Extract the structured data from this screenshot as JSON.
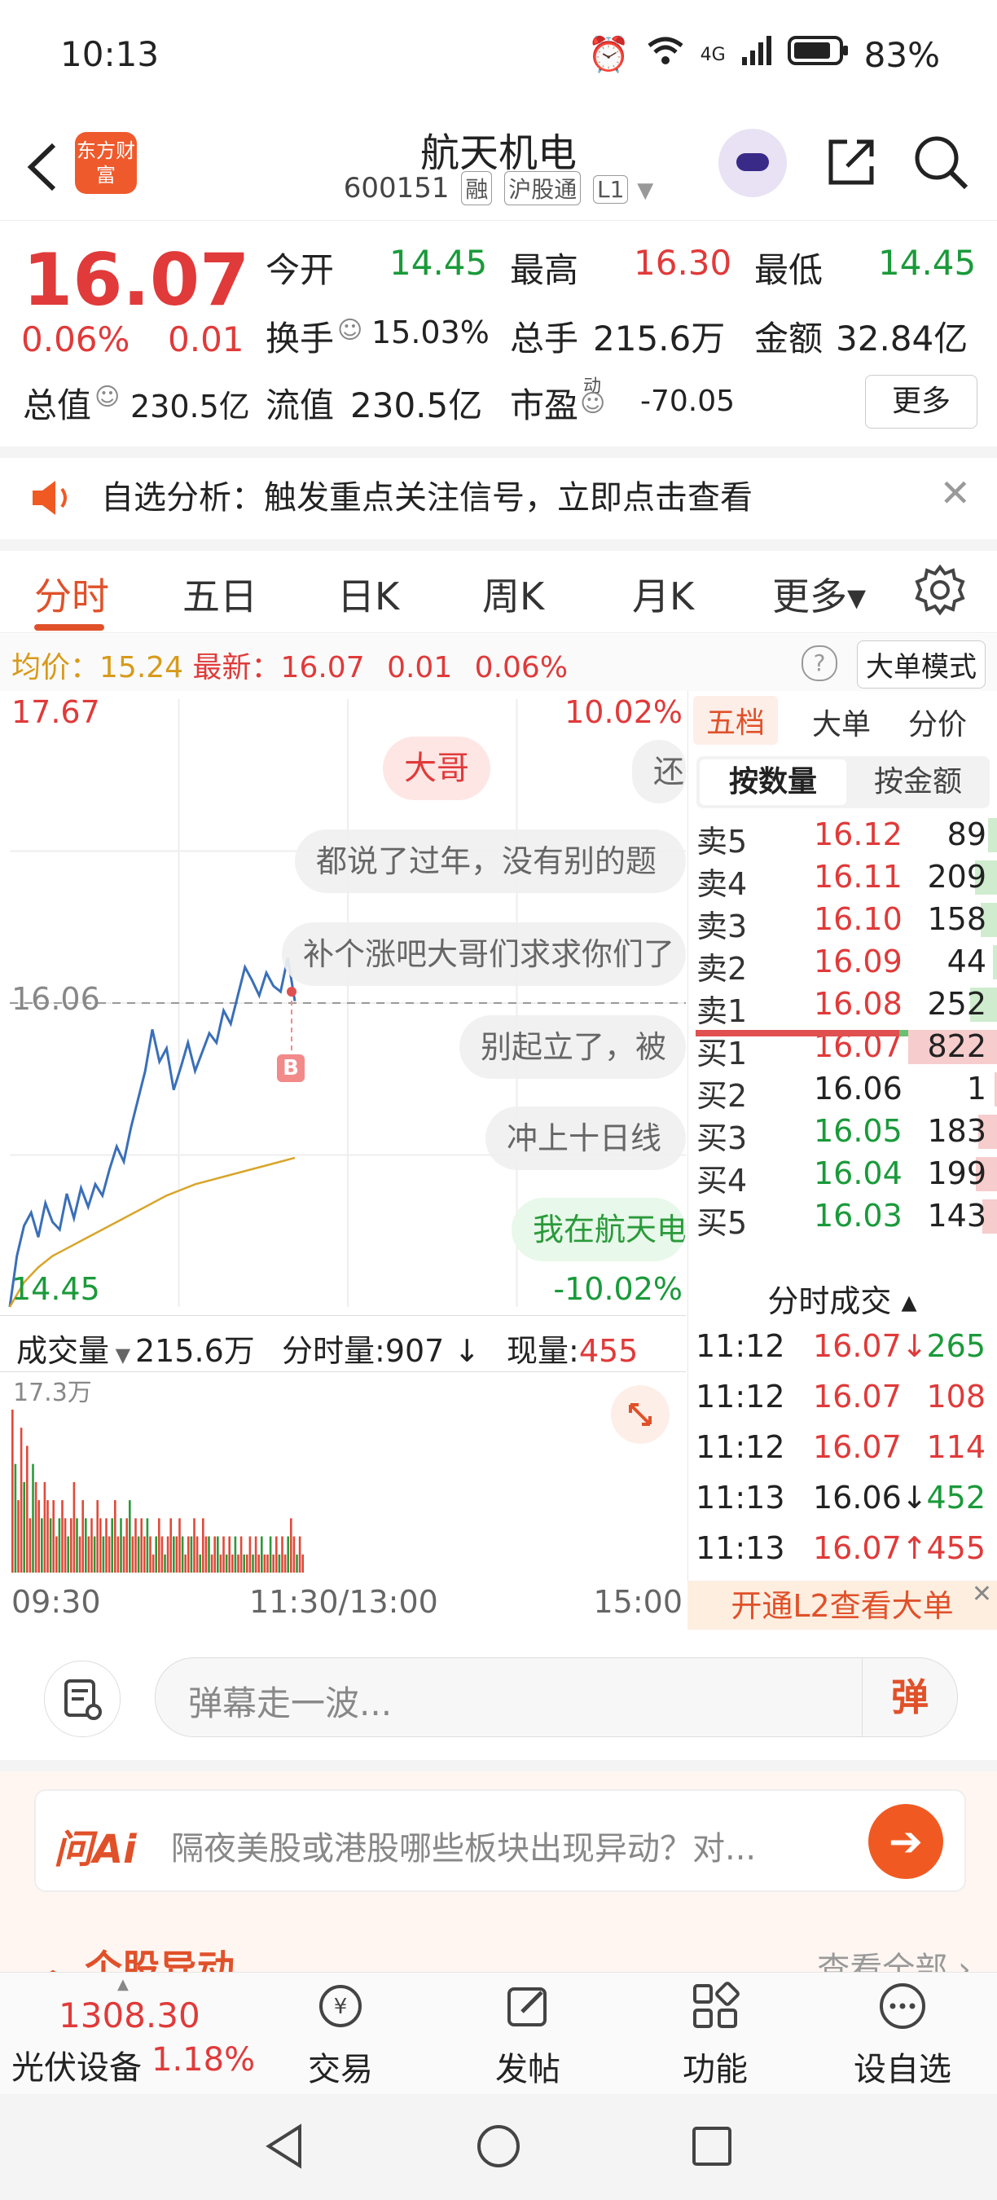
{
  "status_bar": {
    "time": "10:13",
    "network": "4G",
    "battery": "83%"
  },
  "header": {
    "logo_text": "东方财富",
    "stock_name": "航天机电",
    "stock_code": "600151",
    "tags": [
      "融",
      "沪股通",
      "L1"
    ]
  },
  "quote": {
    "price": "16.07",
    "change_pct": "0.06%",
    "change": "0.01",
    "open_label": "今开",
    "open": "14.45",
    "high_label": "最高",
    "high": "16.30",
    "low_label": "最低",
    "low": "14.45",
    "turnover_label": "换手",
    "turnover": "15.03%",
    "volume_label": "总手",
    "volume": "215.6万",
    "amount_label": "金额",
    "amount": "32.84亿",
    "mcap_label": "总值",
    "mcap": "230.5亿",
    "float_label": "流值",
    "float": "230.5亿",
    "pe_label": "市盈",
    "pe_sup": "动",
    "pe": "-70.05",
    "more_label": "更多"
  },
  "notice": {
    "text": "自选分析：触发重点关注信号，立即点击查看"
  },
  "tabs": [
    "分时",
    "五日",
    "日K",
    "周K",
    "月K",
    "更多▾"
  ],
  "avg_row": {
    "avg_label": "均价：",
    "avg": "15.24",
    "latest_label": "最新：",
    "latest": "16.07",
    "change": "0.01",
    "pct": "0.06%",
    "mode": "大单模式"
  },
  "chart": {
    "top_price": "17.67",
    "top_pct": "10.02%",
    "bottom_price": "14.45",
    "bottom_pct": "-10.02%",
    "ref_price": "16.06",
    "marker": "B"
  },
  "chart_data": {
    "type": "line",
    "x_range": [
      "09:30",
      "15:00"
    ],
    "ylim": [
      14.45,
      17.67
    ],
    "series": [
      {
        "values": [
          14.45,
          14.72,
          14.88,
          14.95,
          14.82,
          15.0,
          14.9,
          14.86,
          15.05,
          14.92,
          15.08,
          14.98,
          15.1,
          15.04,
          15.18,
          15.3,
          15.22,
          15.4,
          15.55,
          15.7,
          15.92,
          15.75,
          15.82,
          15.6,
          15.72,
          15.85,
          15.7,
          15.8,
          15.9,
          15.85,
          16.02,
          15.95,
          16.1,
          16.25,
          16.18,
          16.1,
          16.22,
          16.15,
          16.12,
          16.3,
          16.07
        ]
      },
      {
        "values": [
          14.45,
          14.58,
          14.66,
          14.72,
          14.76,
          14.8,
          14.84,
          14.88,
          14.92,
          14.96,
          15.0,
          15.04,
          15.07,
          15.1,
          15.12,
          15.14,
          15.16,
          15.18,
          15.2,
          15.22,
          15.24
        ]
      }
    ]
  },
  "danmu": [
    "大哥",
    "还",
    "都说了过年，没有别的题",
    "补个涨吧大哥们求求你们了",
    "别起立了，被",
    "冲上十日线",
    "我在航天电"
  ],
  "volume_header": {
    "label": "成交量",
    "total": "215.6万",
    "tick_label": "分时量:",
    "tick": "907",
    "now_label": "现量:",
    "now": "455",
    "max": "17.3万"
  },
  "volume_data": [
    9,
    6,
    4,
    8,
    5,
    7,
    3,
    6,
    5,
    4,
    3,
    5,
    4,
    3,
    4,
    2,
    3,
    4,
    3,
    2,
    3,
    5,
    3,
    2,
    4,
    3,
    2,
    3,
    2,
    4,
    3,
    2,
    3,
    2,
    3,
    4,
    2,
    3,
    2,
    3,
    4,
    2,
    3,
    2,
    3,
    2,
    3,
    2,
    1,
    2,
    3,
    2,
    1,
    2,
    3,
    2,
    2,
    3,
    2,
    1,
    2,
    2,
    3,
    2,
    1,
    3,
    2,
    2,
    1,
    2,
    2,
    1,
    2,
    1,
    2,
    1,
    2,
    1,
    2,
    1,
    1,
    2,
    1,
    2,
    1,
    2,
    1,
    1,
    2,
    1,
    2,
    1,
    2,
    1,
    2,
    3,
    2,
    1,
    2,
    1
  ],
  "time_axis": [
    "09:30",
    "11:30/13:00",
    "15:00"
  ],
  "order_book": {
    "tabs": [
      "五档",
      "大单",
      "分价"
    ],
    "seg_on": "按数量",
    "seg_off": "按金额",
    "asks": [
      {
        "label": "卖5",
        "price": "16.12",
        "vol": "89"
      },
      {
        "label": "卖4",
        "price": "16.11",
        "vol": "209"
      },
      {
        "label": "卖3",
        "price": "16.10",
        "vol": "158"
      },
      {
        "label": "卖2",
        "price": "16.09",
        "vol": "44"
      },
      {
        "label": "卖1",
        "price": "16.08",
        "vol": "252"
      }
    ],
    "bids": [
      {
        "label": "买1",
        "price": "16.07",
        "vol": "822"
      },
      {
        "label": "买2",
        "price": "16.06",
        "vol": "1"
      },
      {
        "label": "买3",
        "price": "16.05",
        "vol": "183"
      },
      {
        "label": "买4",
        "price": "16.04",
        "vol": "199"
      },
      {
        "label": "买5",
        "price": "16.03",
        "vol": "143"
      }
    ],
    "trades_title": "分时成交 ▴",
    "trades": [
      {
        "time": "11:12",
        "price": "16.07↓",
        "vol": "265"
      },
      {
        "time": "11:12",
        "price": "16.07",
        "vol": "108"
      },
      {
        "time": "11:12",
        "price": "16.07",
        "vol": "114"
      },
      {
        "time": "11:13",
        "price": "16.06↓",
        "vol": "452"
      },
      {
        "time": "11:13",
        "price": "16.07↑",
        "vol": "455"
      }
    ],
    "l2_banner": "开通L2查看大单"
  },
  "comment": {
    "placeholder": "弹幕走一波...",
    "danmu_btn": "弹"
  },
  "ai": {
    "logo": "问Ai",
    "text": "隔夜美股或港股哪些板块出现异动？对...",
    "section_title": "个股异动",
    "see_all": "查看全部 ›"
  },
  "bottom_nav": {
    "index_value": "1308.30",
    "index_name": "光伏设备",
    "index_pct": "1.18%",
    "items": [
      "交易",
      "发帖",
      "功能",
      "设自选"
    ]
  }
}
